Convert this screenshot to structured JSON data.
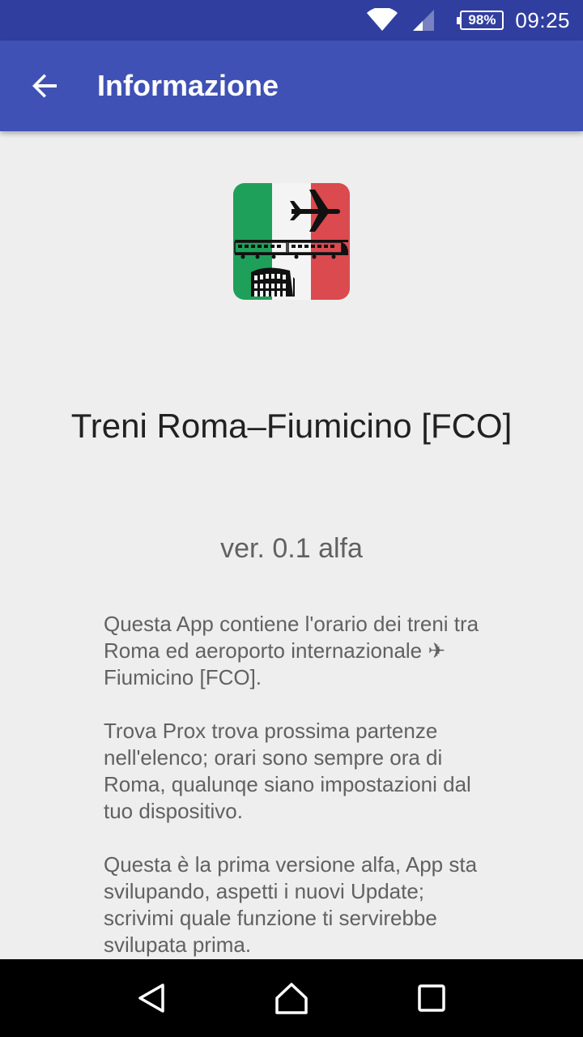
{
  "status_bar": {
    "battery": "98%",
    "time": "09:25",
    "icons": [
      "wifi-icon",
      "signal-icon",
      "battery-icon"
    ]
  },
  "app_bar": {
    "title": "Informazione",
    "back_icon": "arrow-back-icon"
  },
  "about": {
    "app_name": "Treni Roma–Fiumicino [FCO]",
    "version": "ver. 0.1 alfa",
    "paragraphs": [
      "Questa App contiene l'orario dei treni tra Roma ed aeroporto internazionale ✈ Fiumicino [FCO].",
      "Trova Prox trova prossima partenze nell'elenco; orari sono sempre ora di Roma, qualunqe siano impostazioni dal tuo dispositivo.",
      "Questa è la prima versione alfa, App sta svilupando, aspetti i nuovi Update; scrivimi quale funzione ti servirebbe svilupata prima."
    ]
  },
  "nav_bar": {
    "icons": [
      "back-triangle-icon",
      "home-icon",
      "recents-icon"
    ]
  },
  "colors": {
    "status_bar": "#303F9F",
    "app_bar": "#3F51B5",
    "background": "#EEEEEE",
    "flag_green": "#1FA05A",
    "flag_white": "#F4F4F4",
    "flag_red": "#DA4A4F"
  }
}
